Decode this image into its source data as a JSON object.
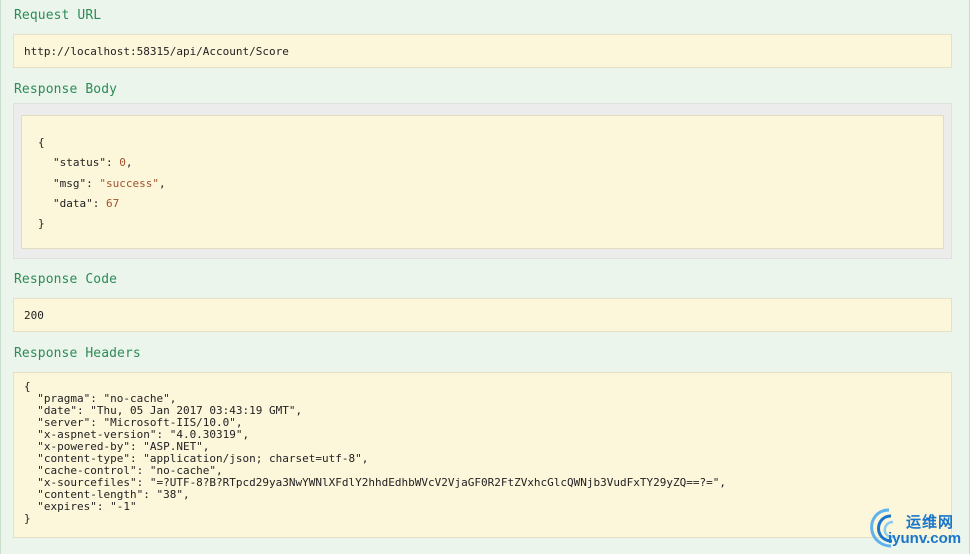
{
  "request_url": {
    "title": "Request URL",
    "value": "http://localhost:58315/api/Account/Score"
  },
  "response_body": {
    "title": "Response Body",
    "lines": [
      {
        "indent": "",
        "text": "{"
      },
      {
        "indent": "  ",
        "key": "\"status\"",
        "sep": ": ",
        "value": "0",
        "value_type": "num",
        "tail": ","
      },
      {
        "indent": "  ",
        "key": "\"msg\"",
        "sep": ": ",
        "value": "\"success\"",
        "value_type": "str",
        "tail": ","
      },
      {
        "indent": "  ",
        "key": "\"data\"",
        "sep": ": ",
        "value": "67",
        "value_type": "num",
        "tail": ""
      },
      {
        "indent": "",
        "text": "}"
      }
    ]
  },
  "response_code": {
    "title": "Response Code",
    "value": "200"
  },
  "response_headers": {
    "title": "Response Headers",
    "lines": [
      "{",
      "  \"pragma\": \"no-cache\",",
      "  \"date\": \"Thu, 05 Jan 2017 03:43:19 GMT\",",
      "  \"server\": \"Microsoft-IIS/10.0\",",
      "  \"x-aspnet-version\": \"4.0.30319\",",
      "  \"x-powered-by\": \"ASP.NET\",",
      "  \"content-type\": \"application/json; charset=utf-8\",",
      "  \"cache-control\": \"no-cache\",",
      "  \"x-sourcefiles\": \"=?UTF-8?B?RTpcd29ya3NwYWNlXFdlY2hhdEdhbWVcV2VjaGF0R2FtZVxhcGlcQWNjb3VudFxTY29yZQ==?=\",",
      "  \"content-length\": \"38\",",
      "  \"expires\": \"-1\"",
      "}"
    ]
  },
  "watermark": {
    "cn": "运维网",
    "en": "iyunv.com",
    "color": "#1a76c9"
  },
  "colors": {
    "title_green": "#2e8b57",
    "box_bg": "#fcf6db",
    "page_bg": "#ebf5ec",
    "value_brown": "#a0522d"
  }
}
